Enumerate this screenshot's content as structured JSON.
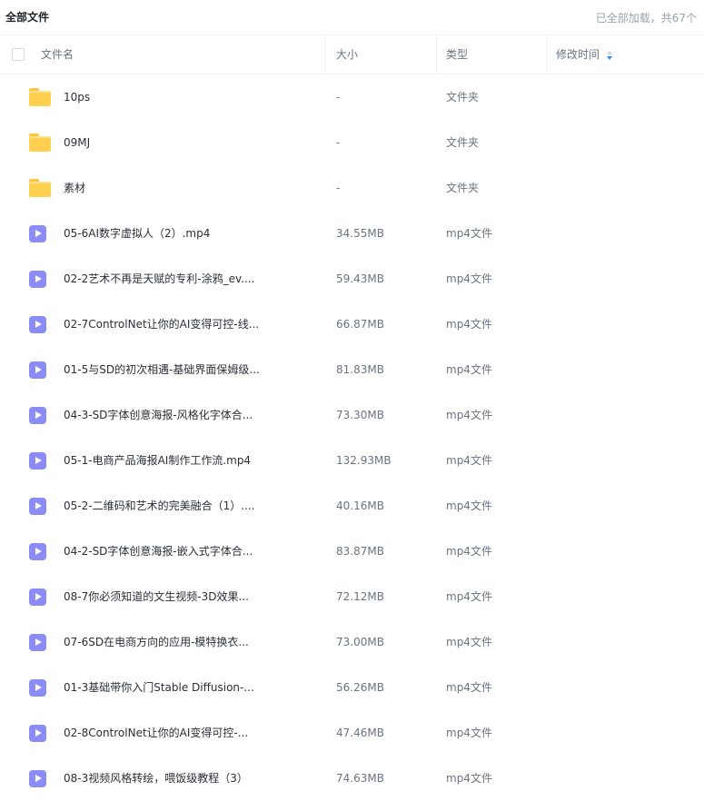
{
  "breadcrumb": {
    "title": "全部文件"
  },
  "status": {
    "loaded_text": "已全部加载，共67个"
  },
  "columns": {
    "name": "文件名",
    "size": "大小",
    "type": "类型",
    "modified": "修改时间"
  },
  "files": [
    {
      "icon": "folder-icon",
      "name": "10ps",
      "size": "-",
      "type": "文件夹"
    },
    {
      "icon": "folder-icon",
      "name": "09MJ",
      "size": "-",
      "type": "文件夹"
    },
    {
      "icon": "folder-icon",
      "name": "素材",
      "size": "-",
      "type": "文件夹"
    },
    {
      "icon": "video-file-icon",
      "name": "05-6AI数字虚拟人（2）.mp4",
      "size": "34.55MB",
      "type": "mp4文件"
    },
    {
      "icon": "video-file-icon",
      "name": "02-2艺术不再是天赋的专利-涂鸦_ev....",
      "size": "59.43MB",
      "type": "mp4文件"
    },
    {
      "icon": "video-file-icon",
      "name": "02-7ControlNet让你的AI变得可控-线...",
      "size": "66.87MB",
      "type": "mp4文件"
    },
    {
      "icon": "video-file-icon",
      "name": "01-5与SD的初次相遇-基础界面保姆级...",
      "size": "81.83MB",
      "type": "mp4文件"
    },
    {
      "icon": "video-file-icon",
      "name": "04-3-SD字体创意海报-风格化字体合...",
      "size": "73.30MB",
      "type": "mp4文件"
    },
    {
      "icon": "video-file-icon",
      "name": "05-1-电商产品海报AI制作工作流.mp4",
      "size": "132.93MB",
      "type": "mp4文件"
    },
    {
      "icon": "video-file-icon",
      "name": "05-2-二维码和艺术的完美融合（1）....",
      "size": "40.16MB",
      "type": "mp4文件"
    },
    {
      "icon": "video-file-icon",
      "name": "04-2-SD字体创意海报-嵌入式字体合...",
      "size": "83.87MB",
      "type": "mp4文件"
    },
    {
      "icon": "video-file-icon",
      "name": "08-7你必须知道的文生视频-3D效果...",
      "size": "72.12MB",
      "type": "mp4文件"
    },
    {
      "icon": "video-file-icon",
      "name": "07-6SD在电商方向的应用-模特换衣...",
      "size": "73.00MB",
      "type": "mp4文件"
    },
    {
      "icon": "video-file-icon",
      "name": "01-3基础带你入门Stable Diffusion-...",
      "size": "56.26MB",
      "type": "mp4文件"
    },
    {
      "icon": "video-file-icon",
      "name": "02-8ControlNet让你的AI变得可控-...",
      "size": "47.46MB",
      "type": "mp4文件"
    },
    {
      "icon": "video-file-icon",
      "name": "08-3视频风格转绘，喂饭级教程（3）",
      "size": "74.63MB",
      "type": "mp4文件"
    }
  ]
}
